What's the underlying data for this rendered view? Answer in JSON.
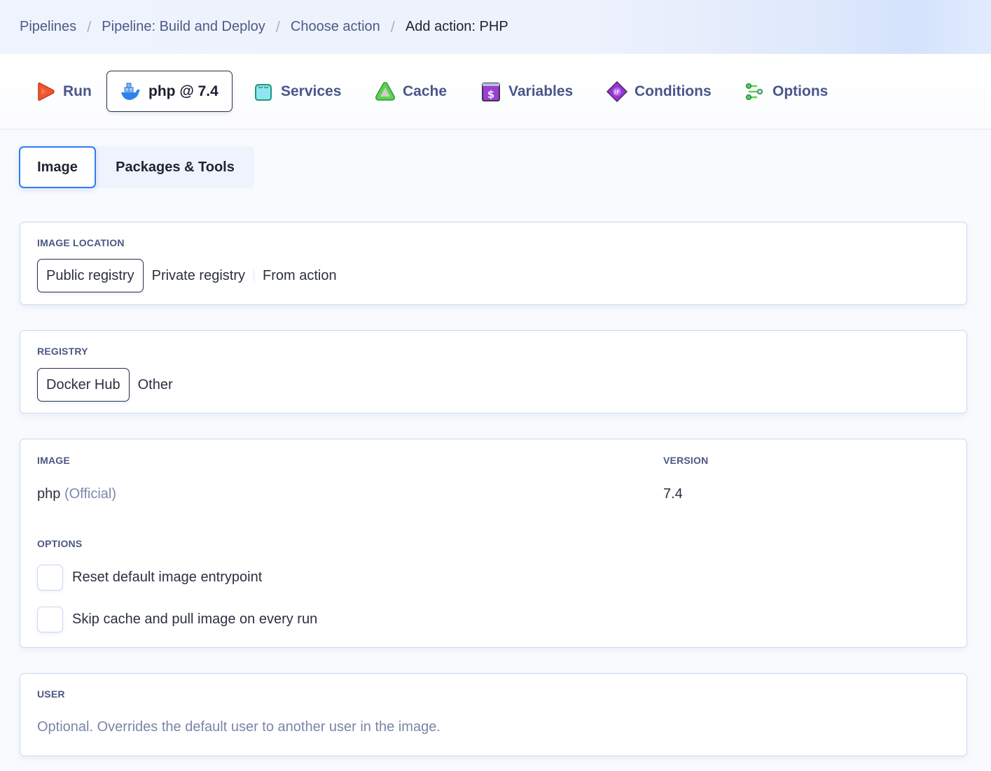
{
  "breadcrumb": {
    "items": [
      {
        "label": "Pipelines"
      },
      {
        "label": "Pipeline: Build and Deploy"
      },
      {
        "label": "Choose action"
      },
      {
        "label": "Add action: PHP"
      }
    ],
    "separator": "/"
  },
  "action_tabs": [
    {
      "label": "Run",
      "icon": "play-icon",
      "active": false
    },
    {
      "label": "php @ 7.4",
      "icon": "docker-whale-icon",
      "active": true
    },
    {
      "label": "Services",
      "icon": "services-box-icon",
      "active": false
    },
    {
      "label": "Cache",
      "icon": "cache-triangle-icon",
      "active": false
    },
    {
      "label": "Variables",
      "icon": "dollar-variables-icon",
      "active": false
    },
    {
      "label": "Conditions",
      "icon": "if-diamond-icon",
      "active": false
    },
    {
      "label": "Options",
      "icon": "sliders-options-icon",
      "active": false
    }
  ],
  "sub_tabs": [
    {
      "label": "Image",
      "active": true
    },
    {
      "label": "Packages & Tools",
      "active": false
    }
  ],
  "image_location": {
    "label": "IMAGE LOCATION",
    "options": [
      "Public registry",
      "Private registry",
      "From action"
    ],
    "selected": "Public registry"
  },
  "registry": {
    "label": "REGISTRY",
    "options": [
      "Docker Hub",
      "Other"
    ],
    "selected": "Docker Hub"
  },
  "image": {
    "label": "IMAGE",
    "name": "php",
    "badge": "(Official)",
    "version_label": "VERSION",
    "version": "7.4",
    "options_label": "OPTIONS",
    "options": [
      {
        "label": "Reset default image entrypoint",
        "checked": false
      },
      {
        "label": "Skip cache and pull image on every run",
        "checked": false
      }
    ]
  },
  "user": {
    "label": "USER",
    "placeholder": "Optional. Overrides the default user to another user in the image."
  },
  "colors": {
    "accent_blue": "#2f7bf5",
    "nav_text": "#4a568a",
    "label_text": "#4c5783",
    "card_border": "#c9d9f2"
  }
}
